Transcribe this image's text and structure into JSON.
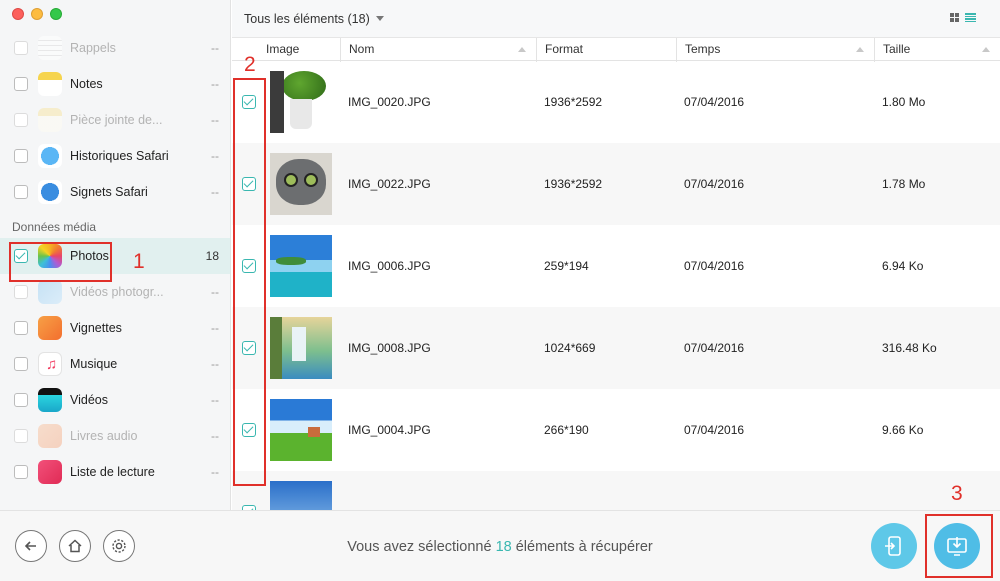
{
  "window": {
    "controls": [
      "close",
      "minimize",
      "zoom"
    ]
  },
  "sidebar": {
    "items_top": [
      {
        "label": "Rappels",
        "count": "--",
        "dim": true,
        "icon": "reminders-icon"
      },
      {
        "label": "Notes",
        "count": "--",
        "dim": false,
        "icon": "notes-icon"
      },
      {
        "label": "Pièce jointe de...",
        "count": "--",
        "dim": true,
        "icon": "attachment-icon"
      },
      {
        "label": "Historiques Safari",
        "count": "--",
        "dim": false,
        "icon": "safari-history-icon"
      },
      {
        "label": "Signets Safari",
        "count": "--",
        "dim": false,
        "icon": "safari-bookmarks-icon"
      }
    ],
    "section_label": "Données média",
    "items_media": [
      {
        "label": "Photos",
        "count": "18",
        "dim": false,
        "checked": true,
        "selected": true,
        "icon": "photos-icon"
      },
      {
        "label": "Vidéos photogr...",
        "count": "--",
        "dim": true,
        "icon": "photo-videos-icon"
      },
      {
        "label": "Vignettes",
        "count": "--",
        "dim": false,
        "icon": "thumbnails-icon"
      },
      {
        "label": "Musique",
        "count": "--",
        "dim": false,
        "icon": "music-icon"
      },
      {
        "label": "Vidéos",
        "count": "--",
        "dim": false,
        "icon": "videos-icon"
      },
      {
        "label": "Livres audio",
        "count": "--",
        "dim": true,
        "icon": "audiobooks-icon"
      },
      {
        "label": "Liste de lecture",
        "count": "--",
        "dim": false,
        "icon": "playlist-icon"
      }
    ]
  },
  "toolbar": {
    "filter_label": "Tous les éléments (18)",
    "view_modes": [
      "grid-view",
      "list-view"
    ],
    "active_view": "list-view"
  },
  "table": {
    "columns": [
      "Image",
      "Nom",
      "Format",
      "Temps",
      "Taille"
    ],
    "rows": [
      {
        "name": "IMG_0020.JPG",
        "format": "1936*2592",
        "time": "07/04/2016",
        "size": "1.80 Mo",
        "checked": true,
        "thumb": "plant"
      },
      {
        "name": "IMG_0022.JPG",
        "format": "1936*2592",
        "time": "07/04/2016",
        "size": "1.78 Mo",
        "checked": true,
        "thumb": "cat"
      },
      {
        "name": "IMG_0006.JPG",
        "format": "259*194",
        "time": "07/04/2016",
        "size": "6.94 Ko",
        "checked": true,
        "thumb": "beach"
      },
      {
        "name": "IMG_0008.JPG",
        "format": "1024*669",
        "time": "07/04/2016",
        "size": "316.48 Ko",
        "checked": true,
        "thumb": "waterfall"
      },
      {
        "name": "IMG_0004.JPG",
        "format": "266*190",
        "time": "07/04/2016",
        "size": "9.66 Ko",
        "checked": true,
        "thumb": "meadow"
      },
      {
        "name": "",
        "format": "",
        "time": "",
        "size": "",
        "checked": true,
        "thumb": "sky"
      }
    ]
  },
  "footer": {
    "status_prefix": "Vous avez sélectionné ",
    "status_count": "18",
    "status_suffix": " éléments à récupérer"
  },
  "annotations": {
    "step1": "1",
    "step2": "2",
    "step3": "3"
  },
  "colors": {
    "accent": "#3ab7b0",
    "annotation": "#e0302a",
    "to_device_button": "#5ec8e8",
    "to_computer_button": "#4fbde6"
  }
}
